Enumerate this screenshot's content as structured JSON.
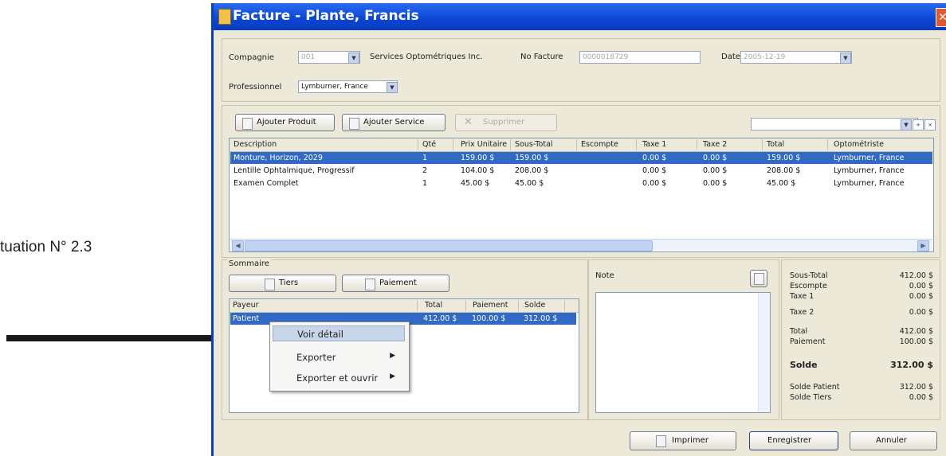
{
  "caption": "tuation N° 2.3",
  "window": {
    "title": "Facture - Plante, Francis",
    "close_glyph": "✕"
  },
  "header": {
    "compagnie_label": "Compagnie",
    "compagnie_value": "001",
    "compagnie_name": "Services Optométriques Inc.",
    "facture_label": "No Facture",
    "facture_value": "0000018729",
    "date_label": "Date",
    "date_value": "2005-12-19",
    "professionnel_label": "Professionnel",
    "professionnel_value": "Lymburner, France"
  },
  "toolbar": {
    "add_product": "Ajouter Produit",
    "add_service": "Ajouter Service",
    "delete": "Supprimer"
  },
  "items_table": {
    "columns": [
      "Description",
      "Qté",
      "Prix Unitaire",
      "Sous-Total",
      "Escompte",
      "Taxe 1",
      "Taxe 2",
      "Total",
      "Optométriste"
    ],
    "rows": [
      [
        "Monture, Horizon, 2029",
        "1",
        "159.00 $",
        "159.00 $",
        "",
        "0.00 $",
        "0.00 $",
        "159.00 $",
        "Lymburner, France"
      ],
      [
        "Lentille Ophtalmique, Progressif",
        "2",
        "104.00 $",
        "208.00 $",
        "",
        "0.00 $",
        "0.00 $",
        "208.00 $",
        "Lymburner, France"
      ],
      [
        "Examen Complet",
        "1",
        "45.00 $",
        "45.00 $",
        "",
        "0.00 $",
        "0.00 $",
        "45.00 $",
        "Lymburner, France"
      ]
    ],
    "selected_row": 0
  },
  "sommaire": {
    "label": "Sommaire",
    "tiers_button": "Tiers",
    "paiement_button": "Paiement",
    "columns": [
      "Payeur",
      "Total",
      "Paiement",
      "Solde"
    ],
    "rows": [
      [
        "Patient",
        "412.00 $",
        "100.00 $",
        "312.00 $"
      ]
    ]
  },
  "context_menu": {
    "items": [
      "Voir détail",
      "Exporter",
      "Exporter et ouvrir"
    ],
    "highlighted": 0
  },
  "note": {
    "label": "Note"
  },
  "totals": {
    "sous_total_label": "Sous-Total",
    "sous_total": "412.00 $",
    "escompte_label": "Escompte",
    "escompte": "0.00 $",
    "taxe1_label": "Taxe 1",
    "taxe1": "0.00 $",
    "taxe2_label": "Taxe 2",
    "taxe2": "0.00 $",
    "total_label": "Total",
    "total": "412.00 $",
    "paiement_label": "Paiement",
    "paiement": "100.00 $",
    "solde_label": "Solde",
    "solde": "312.00 $",
    "solde_patient_label": "Solde Patient",
    "solde_patient": "312.00 $",
    "solde_tiers_label": "Solde Tiers",
    "solde_tiers": "0.00 $"
  },
  "footer": {
    "print": "Imprimer",
    "save": "Enregistrer",
    "cancel": "Annuler"
  }
}
